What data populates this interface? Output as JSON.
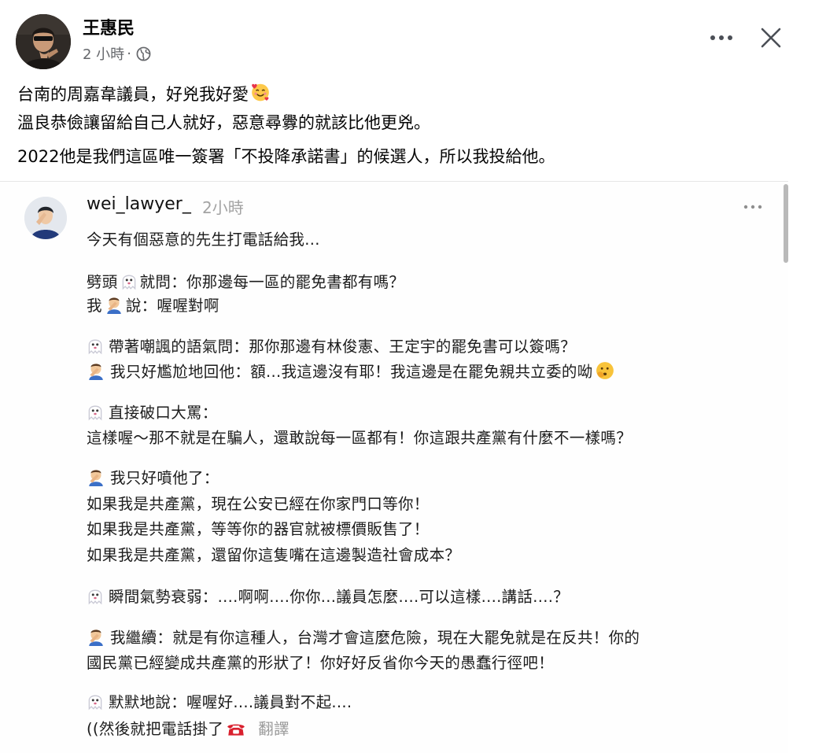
{
  "post": {
    "author": "王惠民",
    "time": "2 小時",
    "dot": "·",
    "body_lines": [
      "台南的周嘉韋議員，好兇我好愛",
      "溫良恭儉讓留給自己人就好，惡意尋釁的就該比他更兇。",
      "2022他是我們這區唯一簽署「不投降承諾書」的候選人，所以我投給他。"
    ]
  },
  "icons": {
    "globe": "globe-icon",
    "more": "more-horizontal-icon",
    "close": "close-icon",
    "ghost": "ghost-emoji",
    "man": "man-facepalm-emoji",
    "peek": "face-peeking-emoji",
    "heart_face": "smiling-face-with-hearts-emoji",
    "phone": "telephone-emoji"
  },
  "colors": {
    "text": "#050505",
    "meta": "#65676b",
    "translate": "#9a9a9a"
  },
  "screenshot": {
    "username": "wei_lawyer_",
    "time": "2小時",
    "line1": "今天有個惡意的先生打電話給我...",
    "p1a_pre": "劈頭",
    "p1a_post": "就問：你那邊每一區的罷免書都有嗎？",
    "p1b_pre": "我",
    "p1b_post": "說：喔喔對啊",
    "p2a": "帶著嘲諷的語氣問：那你那邊有林俊憲、王定宇的罷免書可以簽嗎？",
    "p2b": "我只好尷尬地回他：額...我這邊沒有耶！我這邊是在罷免親共立委的呦",
    "p3a": "直接破口大罵：",
    "p3b": "這樣喔～那不就是在騙人，還敢說每一區都有！你這跟共產黨有什麼不一樣嗎？",
    "p4a": "我只好噴他了：",
    "p4b": "如果我是共產黨，現在公安已經在你家門口等你！",
    "p4c": "如果我是共產黨，等等你的器官就被標價販售了！",
    "p4d": "如果我是共產黨，還留你這隻嘴在這邊製造社會成本？",
    "p5": "瞬間氣勢衰弱：....啊啊....你你...議員怎麼....可以這樣....講話....？",
    "p6a": "我繼續：就是有你這種人，台灣才會這麼危險，現在大罷免就是在反共！你的",
    "p6b": "國民黨已經變成共產黨的形狀了！你好好反省你今天的愚蠢行徑吧！",
    "p7a": "默默地說：喔喔好....議員對不起....",
    "p7b": "((然後就把電話掛了",
    "translate": "翻譯"
  }
}
